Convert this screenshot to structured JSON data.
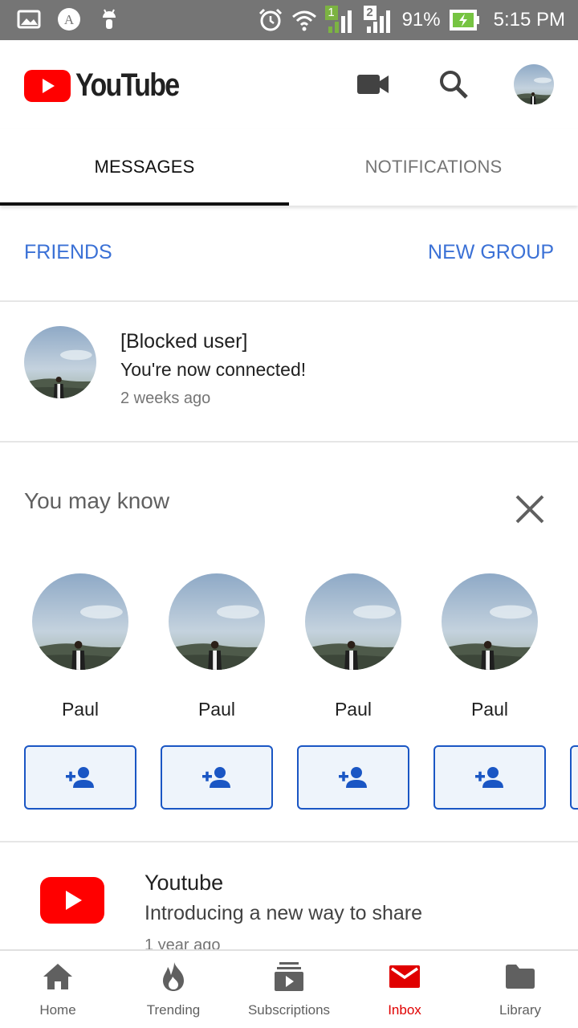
{
  "status_bar": {
    "battery": "91%",
    "time": "5:15 PM",
    "sim1": "1",
    "sim2": "2",
    "icons": [
      "gallery-icon",
      "a-badge-icon",
      "android-icon",
      "alarm-icon",
      "wifi-icon",
      "signal-icon",
      "battery-charging-icon"
    ]
  },
  "app_bar": {
    "logo_text": "YouTube",
    "icons": [
      "video-camera-icon",
      "search-icon",
      "account-avatar"
    ]
  },
  "tabs": [
    {
      "label": "MESSAGES",
      "active": true
    },
    {
      "label": "NOTIFICATIONS",
      "active": false
    }
  ],
  "links": {
    "friends": "FRIENDS",
    "new_group": "NEW GROUP"
  },
  "message": {
    "title": "[Blocked user]",
    "subtitle": "You're now connected!",
    "time": "2 weeks ago"
  },
  "you_may_know": {
    "title": "You may know",
    "people": [
      {
        "name": "Paul"
      },
      {
        "name": "Paul"
      },
      {
        "name": "Paul"
      },
      {
        "name": "Paul"
      }
    ]
  },
  "youtube_item": {
    "title": "Youtube",
    "subtitle": "Introducing a new way to share",
    "time": "1 year ago"
  },
  "bottom_nav": [
    {
      "label": "Home",
      "icon": "home-icon",
      "active": false
    },
    {
      "label": "Trending",
      "icon": "flame-icon",
      "active": false
    },
    {
      "label": "Subscriptions",
      "icon": "subscriptions-icon",
      "active": false
    },
    {
      "label": "Inbox",
      "icon": "mail-icon",
      "active": true
    },
    {
      "label": "Library",
      "icon": "folder-icon",
      "active": false
    }
  ],
  "colors": {
    "accent_red": "#ff0000",
    "link_blue": "#3b71d6",
    "add_button_border": "#1a56c4",
    "status_bar": "#757575"
  }
}
